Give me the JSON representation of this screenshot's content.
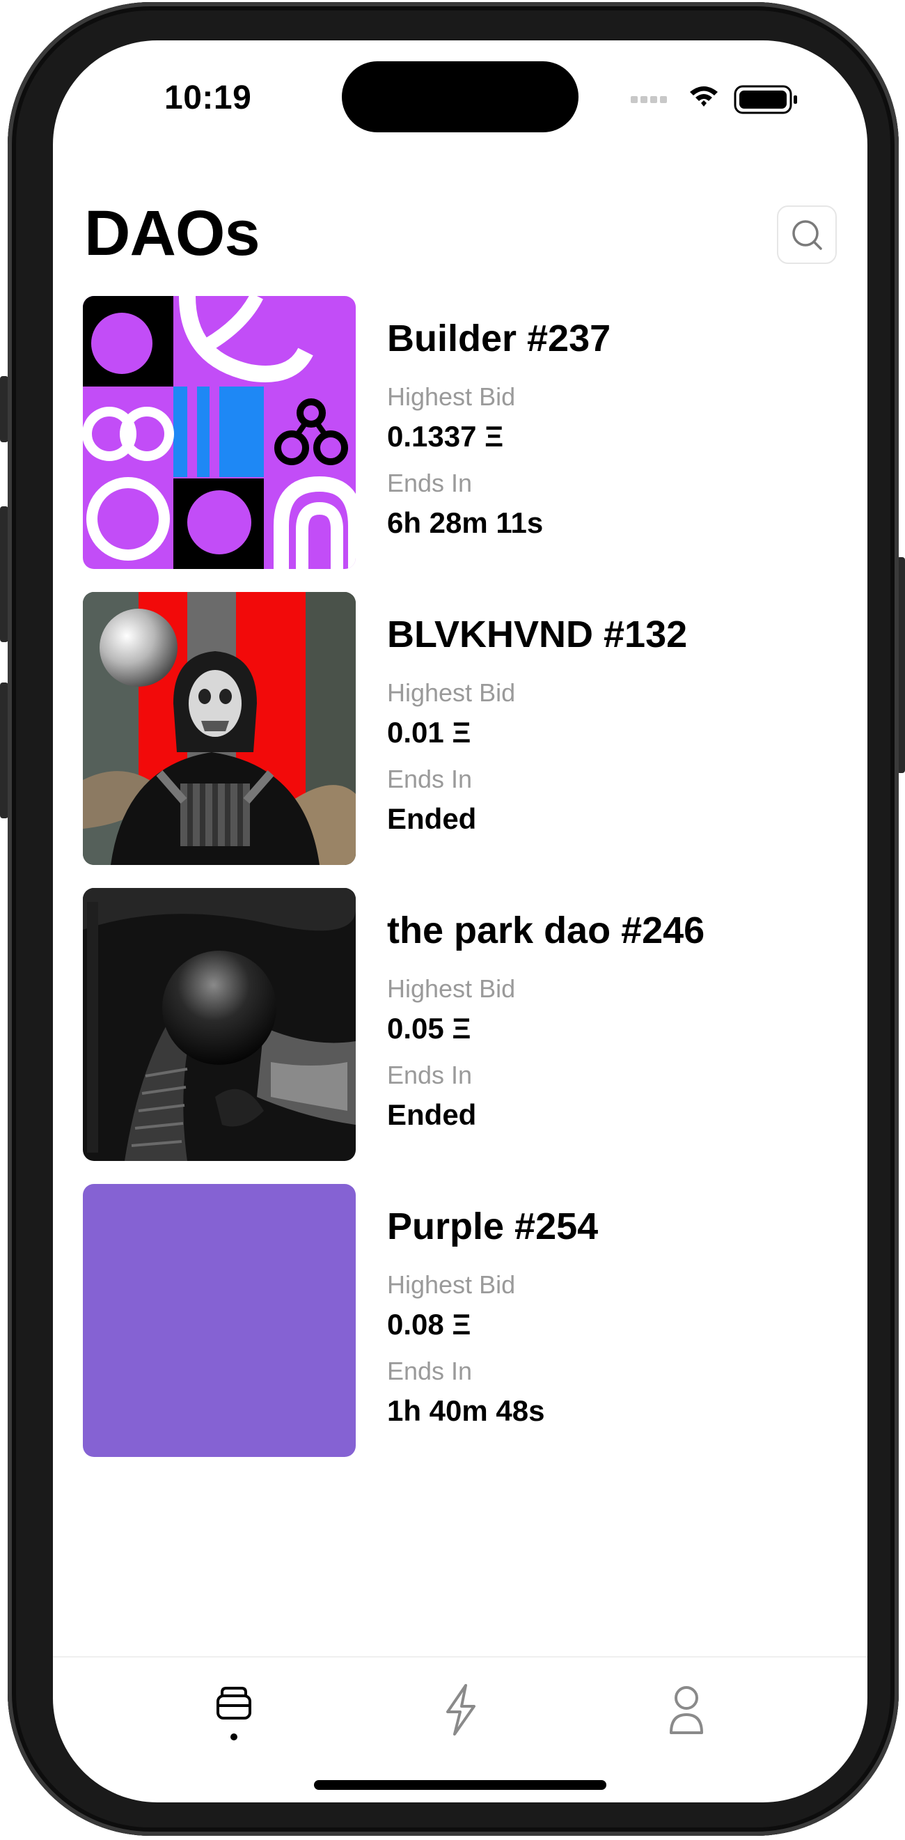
{
  "status_bar": {
    "time": "10:19"
  },
  "header": {
    "title": "DAOs"
  },
  "daos": [
    {
      "name": "Builder #237",
      "bid_label": "Highest Bid",
      "bid": "0.1337 Ξ",
      "ends_label": "Ends In",
      "ends": "6h 28m 11s"
    },
    {
      "name": "BLVKHVND #132",
      "bid_label": "Highest Bid",
      "bid": "0.01 Ξ",
      "ends_label": "Ends In",
      "ends": "Ended"
    },
    {
      "name": "the park dao #246",
      "bid_label": "Highest Bid",
      "bid": "0.05 Ξ",
      "ends_label": "Ends In",
      "ends": "Ended"
    },
    {
      "name": "Purple #254",
      "bid_label": "Highest Bid",
      "bid": "0.08 Ξ",
      "ends_label": "Ends In",
      "ends": "1h 40m 48s"
    }
  ],
  "tab_bar": {
    "tabs": [
      {
        "icon": "stack-icon",
        "selected": true
      },
      {
        "icon": "lightning-icon",
        "selected": false
      },
      {
        "icon": "person-icon",
        "selected": false
      }
    ]
  },
  "colors": {
    "purple_tile": "#8562D3",
    "builder_magenta": "#C24DF7",
    "builder_blue": "#1E88F5",
    "blvkhvnd_red": "#F20A0A",
    "label_gray": "#9A9A9A"
  }
}
